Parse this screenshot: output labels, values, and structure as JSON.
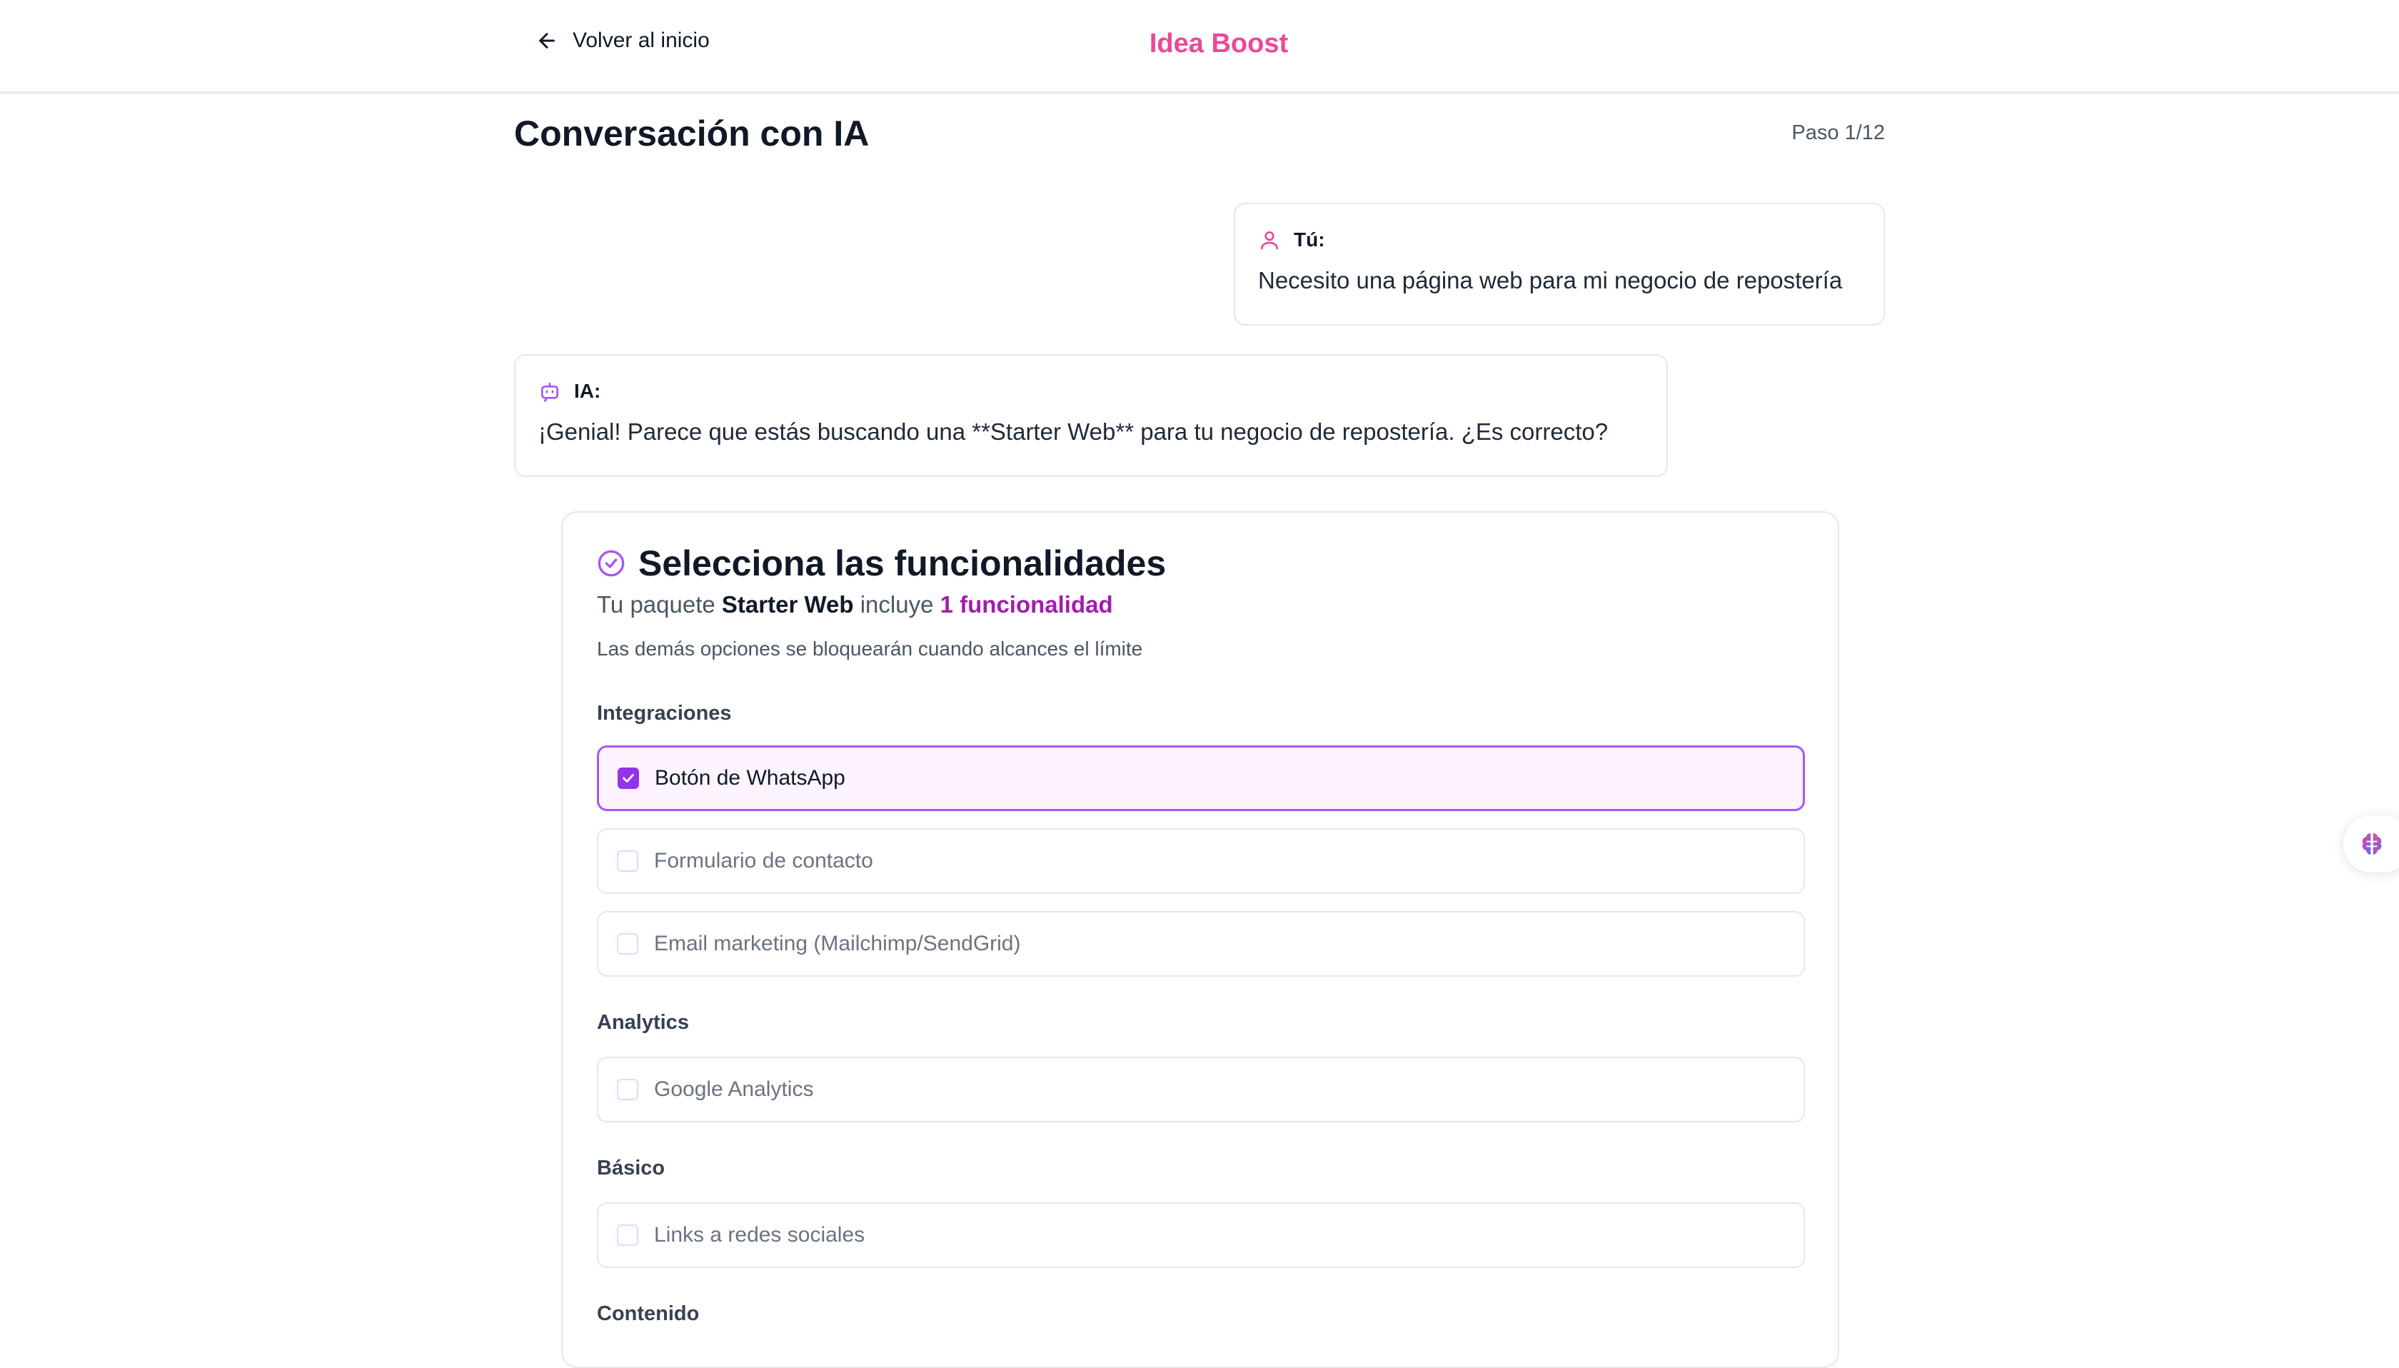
{
  "header": {
    "back_label": "Volver al inicio",
    "brand": "Idea Boost"
  },
  "page": {
    "title": "Conversación con IA",
    "step": "Paso 1/12"
  },
  "chat": [
    {
      "author": "Tú:",
      "text": "Necesito una página web para mi negocio de repostería",
      "icon": "user-icon"
    },
    {
      "author": "IA:",
      "text": "¡Genial! Parece que estás buscando una **Starter Web** para tu negocio de repostería. ¿Es correcto?",
      "icon": "bot-icon"
    }
  ],
  "features_card": {
    "title": "Selecciona las funcionalidades",
    "subtitle_prefix": "Tu paquete",
    "package_name": "Starter Web",
    "subtitle_mid": "incluye",
    "included_count": "1 funcionalidad",
    "note": "Las demás opciones se bloquearán cuando alcances el límite",
    "groups": [
      {
        "label": "Integraciones",
        "options": [
          {
            "label": "Botón de WhatsApp",
            "checked": true
          },
          {
            "label": "Formulario de contacto",
            "checked": false
          },
          {
            "label": "Email marketing (Mailchimp/SendGrid)",
            "checked": false
          }
        ]
      },
      {
        "label": "Analytics",
        "options": [
          {
            "label": "Google Analytics",
            "checked": false
          }
        ]
      },
      {
        "label": "Básico",
        "options": [
          {
            "label": "Links a redes sociales",
            "checked": false
          }
        ]
      },
      {
        "label": "Contenido",
        "options": []
      }
    ]
  },
  "colors": {
    "brand": "#ec4899",
    "accent": "#9333ea",
    "selected_bg": "#fdf4ff",
    "border": "#e5e7eb"
  },
  "floating_button": {
    "icon": "brain-icon"
  }
}
